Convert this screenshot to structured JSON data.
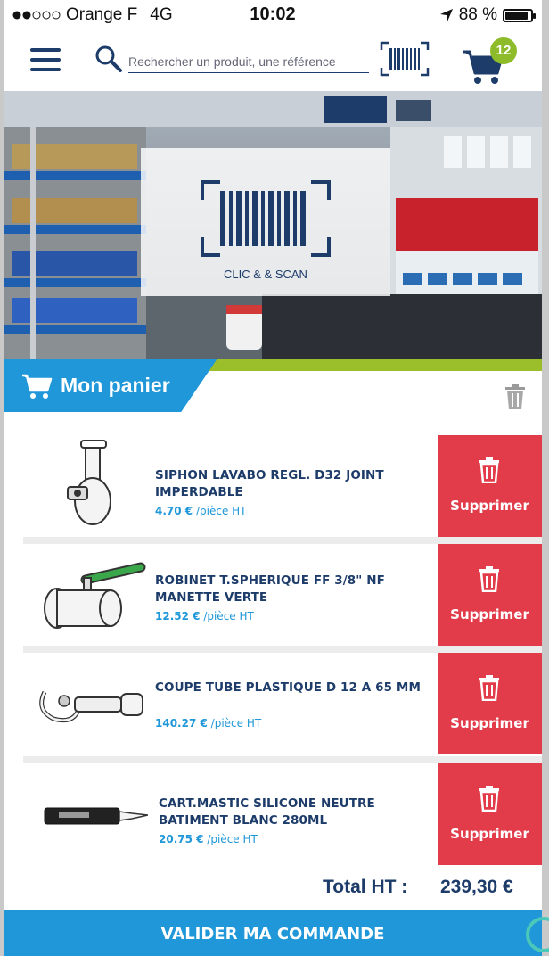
{
  "status_bar": {
    "carrier": "Orange F",
    "network": "4G",
    "time": "10:02",
    "battery": "88 %",
    "battery_level": 0.88
  },
  "toolbar": {
    "menu_icon": "hamburger-menu-icon",
    "search_placeholder": "Rechercher un produit, une référence",
    "cart_count": "12"
  },
  "hero": {
    "scan_label": "CLIC & & SCAN"
  },
  "cart": {
    "title": "Mon panier",
    "items": [
      {
        "name": "SIPHON LAVABO REGL. D32 JOINT IMPERDABLE",
        "price": "4.70 €",
        "unit": "/pièce HT",
        "delete_label": "Supprimer"
      },
      {
        "name": "ROBINET T.SPHERIQUE FF 3/8\" NF MANETTE VERTE",
        "price": "12.52 €",
        "unit": "/pièce HT",
        "delete_label": "Supprimer"
      },
      {
        "name": "COUPE TUBE PLASTIQUE D 12 A 65 MM",
        "price": "140.27 €",
        "unit": "/pièce HT",
        "delete_label": "Supprimer"
      },
      {
        "name": "CART.MASTIC SILICONE NEUTRE BATIMENT BLANC 280ML",
        "price": "20.75 €",
        "unit": "/pièce HT",
        "delete_label": "Supprimer"
      }
    ],
    "total_label": "Total HT :",
    "total_value": "239,30 €",
    "validate_label": "VALIDER MA COMMANDE"
  },
  "colors": {
    "navy": "#1d3c6a",
    "blue": "#1f97d8",
    "green": "#9bbf2a",
    "red": "#e23b49"
  }
}
